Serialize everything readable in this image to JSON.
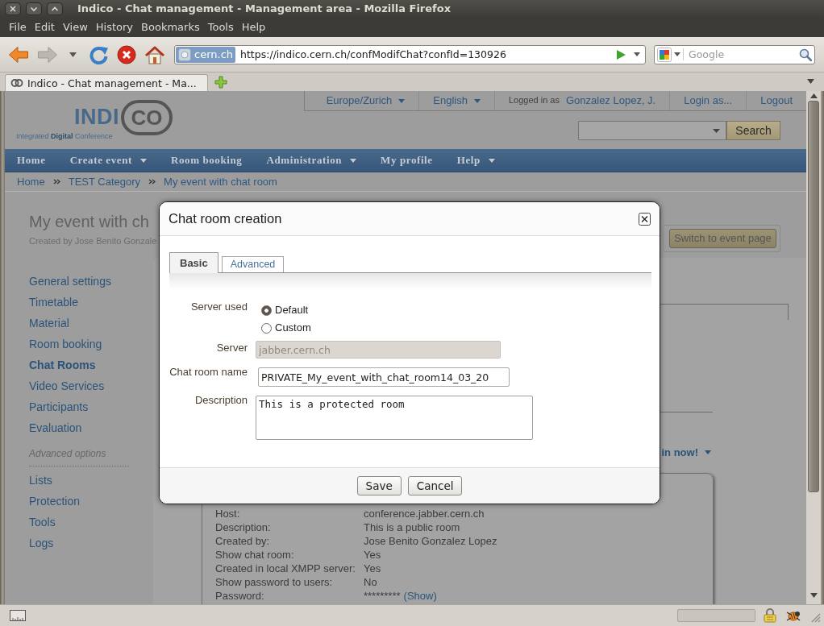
{
  "window": {
    "title": "Indico - Chat management - Management area - Mozilla Firefox"
  },
  "menu_bar": [
    "File",
    "Edit",
    "View",
    "History",
    "Bookmarks",
    "Tools",
    "Help"
  ],
  "navigation": {
    "buttons": [
      {
        "kind": "back",
        "disabled": false
      },
      {
        "kind": "forward",
        "disabled": true
      },
      {
        "kind": "history",
        "disabled": false
      },
      {
        "kind": "reload",
        "disabled": false
      },
      {
        "kind": "stop",
        "disabled": false
      },
      {
        "kind": "home",
        "disabled": false
      }
    ],
    "identity": "cern.ch",
    "url": "https://indico.cern.ch/confModifChat?confId=130926",
    "search_placeholder": "Google"
  },
  "tabs": [
    {
      "label": "Indico - Chat management - Ma...",
      "selected": true
    }
  ],
  "page": {
    "top_bar": [
      {
        "kind": "menu",
        "label": "Europe/Zurich",
        "dropdown": true
      },
      {
        "kind": "menu",
        "label": "English",
        "dropdown": true
      },
      {
        "kind": "user",
        "prefix": "Logged in as",
        "label": "Gonzalez Lopez, J.",
        "dropdown": false
      },
      {
        "kind": "menu",
        "label": "Login as...",
        "dropdown": false
      },
      {
        "kind": "menu",
        "label": "Logout",
        "dropdown": false
      }
    ],
    "logo": {
      "wordmark": "INDI",
      "wordmark_end": "CO",
      "tagline": "Integrated **Digital** Conference"
    },
    "search_button": "Search",
    "nav": [
      {
        "label": "Home",
        "dropdown": false
      },
      {
        "label": "Create event",
        "dropdown": true
      },
      {
        "label": "Room booking",
        "dropdown": false
      },
      {
        "label": "Administration",
        "dropdown": true
      },
      {
        "label": "My profile",
        "dropdown": false
      },
      {
        "label": "Help",
        "dropdown": true
      }
    ],
    "breadcrumb": [
      "Home",
      "TEST Category",
      "My event with chat room"
    ],
    "event": {
      "title": "My event with ch",
      "creator": "Created by Jose Benito Gonzale",
      "switch_button": "Switch to event page"
    },
    "sidebar": {
      "items": [
        {
          "label": "General settings",
          "selected": false
        },
        {
          "label": "Timetable",
          "selected": false
        },
        {
          "label": "Material",
          "selected": false
        },
        {
          "label": "Room booking",
          "selected": false
        },
        {
          "label": "Chat Rooms",
          "selected": true
        },
        {
          "label": "Video Services",
          "selected": false
        },
        {
          "label": "Participants",
          "selected": false
        },
        {
          "label": "Evaluation",
          "selected": false
        }
      ],
      "section": "Advanced options",
      "section_items": [
        {
          "label": "Lists",
          "selected": false
        },
        {
          "label": "Protection",
          "selected": false
        },
        {
          "label": "Tools",
          "selected": false
        },
        {
          "label": "Logs",
          "selected": false
        }
      ]
    },
    "chat_room": {
      "join_link": "in now!",
      "details": [
        {
          "label": "Host:",
          "value": "conference.jabber.cern.ch"
        },
        {
          "label": "Description:",
          "value": "This is a public room"
        },
        {
          "label": "Created by:",
          "value": "Jose Benito Gonzalez Lopez"
        },
        {
          "label": "Show chat room:",
          "value": "Yes"
        },
        {
          "label": "Created in local XMPP server:",
          "value": "Yes"
        },
        {
          "label": "Show password to users:",
          "value": "No"
        },
        {
          "label": "Password:",
          "value": "*********",
          "link": "(Show)"
        }
      ]
    }
  },
  "dialog": {
    "title": "Chat room creation",
    "tabs": [
      {
        "label": "Basic",
        "selected": true
      },
      {
        "label": "Advanced",
        "selected": false
      }
    ],
    "fields": [
      {
        "kind": "radio",
        "label": "Server used",
        "disabled": false,
        "options": [
          {
            "label": "Default",
            "selected": true
          },
          {
            "label": "Custom",
            "selected": false
          }
        ]
      },
      {
        "kind": "text",
        "label": "Server",
        "value": "jabber.cern.ch",
        "disabled": true
      },
      {
        "kind": "text",
        "label": "Chat room name",
        "value": "PRIVATE_My_event_with_chat_room14_03_20",
        "disabled": false
      },
      {
        "kind": "textarea",
        "label": "Description",
        "value": "This is a protected room",
        "disabled": false
      }
    ],
    "buttons": [
      "Save",
      "Cancel"
    ]
  }
}
